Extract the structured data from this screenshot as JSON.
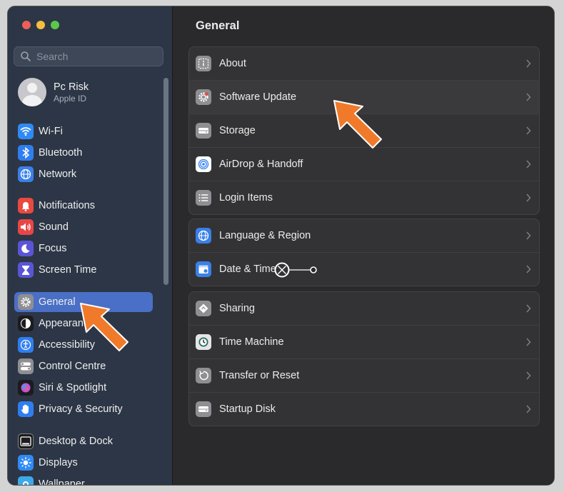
{
  "window": {
    "traffic_lights": {
      "close": "#ee5f58",
      "minimize": "#f6bd3e",
      "zoom": "#5bc84a"
    }
  },
  "sidebar": {
    "search_placeholder": "Search",
    "account": {
      "name": "Pc Risk",
      "subtitle": "Apple ID"
    },
    "items": [
      {
        "label": "Wi-Fi",
        "icon": "wifi-icon",
        "color": "#2f8af5"
      },
      {
        "label": "Bluetooth",
        "icon": "bluetooth-icon",
        "color": "#2f7ef0"
      },
      {
        "label": "Network",
        "icon": "globe-icon",
        "color": "#3a80e8"
      },
      {
        "label": "Notifications",
        "icon": "bell-icon",
        "color": "#e9493e"
      },
      {
        "label": "Sound",
        "icon": "speaker-icon",
        "color": "#e84646"
      },
      {
        "label": "Focus",
        "icon": "moon-icon",
        "color": "#5a55d6"
      },
      {
        "label": "Screen Time",
        "icon": "hourglass-icon",
        "color": "#5a55d6"
      },
      {
        "label": "General",
        "icon": "gear-icon",
        "color": "#8e8e93",
        "selected": true
      },
      {
        "label": "Appearance",
        "icon": "appearance-icon",
        "color": "#1c1c1e"
      },
      {
        "label": "Accessibility",
        "icon": "accessibility-icon",
        "color": "#2f7ef0"
      },
      {
        "label": "Control Centre",
        "icon": "toggles-icon",
        "color": "#8e8e93"
      },
      {
        "label": "Siri & Spotlight",
        "icon": "siri-icon",
        "color": "#1c1c1e"
      },
      {
        "label": "Privacy & Security",
        "icon": "hand-icon",
        "color": "#2f7ef0"
      },
      {
        "label": "Desktop & Dock",
        "icon": "dock-icon",
        "color": "#1c1c1e"
      },
      {
        "label": "Displays",
        "icon": "sun-icon",
        "color": "#2f8af5"
      },
      {
        "label": "Wallpaper",
        "icon": "wallpaper-icon",
        "color": "#3fa8e8"
      }
    ]
  },
  "main": {
    "title": "General",
    "groups": [
      [
        {
          "label": "About",
          "icon": "info-icon"
        },
        {
          "label": "Software Update",
          "icon": "gear-badge-icon",
          "highlighted": true
        },
        {
          "label": "Storage",
          "icon": "disk-icon"
        },
        {
          "label": "AirDrop & Handoff",
          "icon": "airdrop-icon"
        },
        {
          "label": "Login Items",
          "icon": "list-icon"
        }
      ],
      [
        {
          "label": "Language & Region",
          "icon": "globe-icon"
        },
        {
          "label": "Date & Time",
          "icon": "calendar-icon"
        }
      ],
      [
        {
          "label": "Sharing",
          "icon": "sharing-icon"
        },
        {
          "label": "Time Machine",
          "icon": "clock-icon"
        },
        {
          "label": "Transfer or Reset",
          "icon": "reset-icon"
        },
        {
          "label": "Startup Disk",
          "icon": "disk-icon"
        }
      ]
    ]
  },
  "annotations": {
    "arrow_color": "#f07a2a"
  }
}
